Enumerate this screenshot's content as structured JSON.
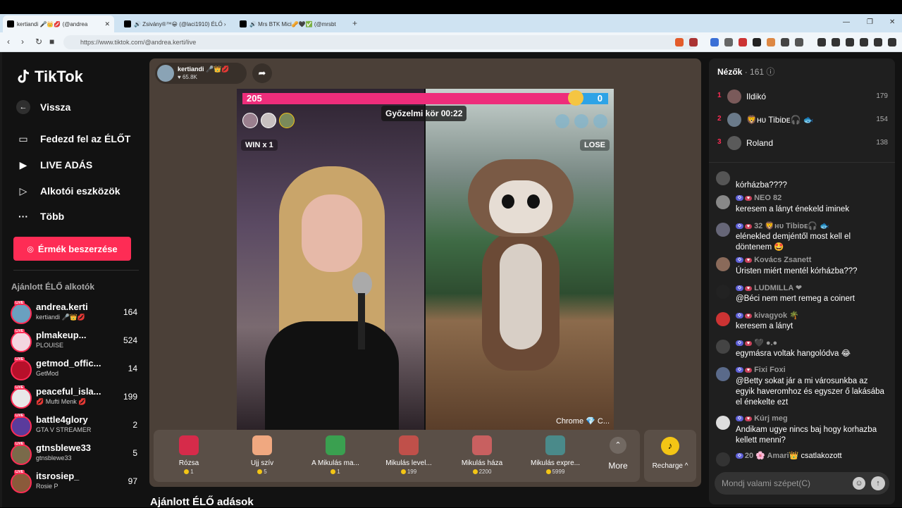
{
  "browser": {
    "tabs": [
      {
        "title": "kertiandi 🎤👑💋 (@andrea",
        "active": true
      },
      {
        "title": "🔊 Zsivány®™😀 (@laci1910) ÉLŐ ›",
        "active": false
      },
      {
        "title": "🔊 Mrs BTK Mici🥜🖤✅ (@mrsbt",
        "active": false
      }
    ],
    "new_tab": "+",
    "url": "https://www.tiktok.com/@andrea.kerti/live"
  },
  "sidebar": {
    "logo": "TikTok",
    "back": "Vissza",
    "nav": [
      "Fedezd fel az ÉLŐT",
      "LIVE ADÁS",
      "Alkotói eszközök",
      "Több"
    ],
    "coins_button": "Érmék beszerzése",
    "recommended_title": "Ajánlott ÉLŐ alkotók",
    "creators": [
      {
        "name": "andrea.kerti",
        "sub": "kertiandi 🎤👑💋",
        "count": "164",
        "color": "#6aa0c0"
      },
      {
        "name": "plmakeup...",
        "sub": "PLOUISE",
        "count": "524",
        "color": "#f3d6e0"
      },
      {
        "name": "getmod_offic...",
        "sub": "GetMod",
        "count": "14",
        "color": "#b7102a"
      },
      {
        "name": "peaceful_isla...",
        "sub": "💋 Mufti Menk 💋",
        "count": "199",
        "color": "#e8e8e8"
      },
      {
        "name": "battle4glory",
        "sub": "GTA V STREAMER",
        "count": "2",
        "color": "#5a3b9c"
      },
      {
        "name": "gtnsblewe33",
        "sub": "gtnsblewe33",
        "count": "5",
        "color": "#7a6a4a"
      },
      {
        "name": "itsrosiep_",
        "sub": "Rosie P",
        "count": "97",
        "color": "#8a5a3a"
      }
    ],
    "live_badge": "LIVE"
  },
  "player": {
    "host_name": "kertiandi 🎤👑💋",
    "host_likes": "♥ 65.8K",
    "score_left": "205",
    "score_right": "0",
    "timer": "Győzelmi kör 00:22",
    "win_label": "WIN x 1",
    "lose_label": "LOSE",
    "caption": "Chrome 💎 C...",
    "gifts": [
      {
        "name": "Rózsa",
        "price": "1",
        "color": "#d62b4a"
      },
      {
        "name": "Ujj szív",
        "price": "5",
        "color": "#f0a880"
      },
      {
        "name": "A Mikulás ma...",
        "price": "1",
        "color": "#3aa050"
      },
      {
        "name": "Mikulás level...",
        "price": "199",
        "color": "#c0504a"
      },
      {
        "name": "Mikulás háza",
        "price": "2200",
        "color": "#c86060"
      },
      {
        "name": "Mikulás expre...",
        "price": "5999",
        "color": "#4a8a8a"
      }
    ],
    "more_label": "More",
    "recharge_label": "Recharge ^"
  },
  "recommended_live": "Ajánlott ÉLŐ adások",
  "chat": {
    "viewers_label": "Nézők",
    "viewers_count": "161",
    "top_viewers": [
      {
        "rank": "1",
        "name": "Ildikó",
        "score": "179"
      },
      {
        "rank": "2",
        "name": "🦁ʜᴜ Tibiᴅᴇ🎧 🐟",
        "score": "154"
      },
      {
        "rank": "3",
        "name": "Roland",
        "score": "138"
      }
    ],
    "messages": [
      {
        "head": "",
        "text": "kórházba????"
      },
      {
        "head": "NEO 82",
        "text": "keresem a lányt énekeld iminek"
      },
      {
        "head": "32 🦁ʜᴜ Tibiᴅᴇ🎧 🐟",
        "text": "elénekled demjéntől most kell el döntenem 🤩"
      },
      {
        "head": "Kovács Zsanett",
        "text": "Úristen miért mentél kórházba???"
      },
      {
        "head": "LUDMILLA ❤",
        "text": "@Béci nem mert remeg a coinert"
      },
      {
        "head": "kivagyok 🌴",
        "text": "keresem a lányt"
      },
      {
        "head": "🖤 ●.●",
        "text": "egymásra voltak hangolódva 😂"
      },
      {
        "head": "Fixi Foxi",
        "text": "@Betty sokat jár a mi városunkba az egyik haveromhoz és egyszer ő lakásába el énekelte ezt"
      },
      {
        "head": "Kúrj meg",
        "text": "Andikam ugye nincs baj hogy korhazba kellett menni?"
      },
      {
        "head": "20 🌸 Amari👑",
        "text": "csatlakozott"
      }
    ],
    "input_placeholder": "Mondj valami szépet(C)"
  }
}
